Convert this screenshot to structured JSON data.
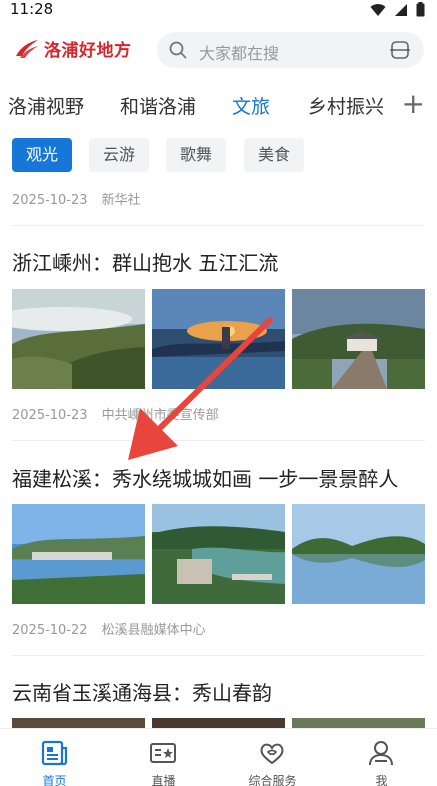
{
  "status_bar": {
    "time": "11:28",
    "icons": [
      "wifi-icon",
      "signal-icon",
      "battery-icon"
    ]
  },
  "header": {
    "logo_text": "洛浦好地方",
    "search_placeholder": "大家都在搜"
  },
  "tabs": {
    "items": [
      "洛浦视野",
      "和谐洛浦",
      "文旅",
      "乡村振兴"
    ],
    "active": "文旅",
    "more_label": "+"
  },
  "subtabs": {
    "items": [
      "观光",
      "云游",
      "歌舞",
      "美食"
    ],
    "active": "观光"
  },
  "feed": [
    {
      "date": "2025-10-23",
      "source": "新华社"
    },
    {
      "title": "浙江嵊州：群山抱水 五江汇流",
      "date": "2025-10-23",
      "source": "中共嵊州市委宣传部"
    },
    {
      "title": "福建松溪：秀水绕城城如画 一步一景景醉人",
      "date": "2025-10-22",
      "source": "松溪县融媒体中心"
    },
    {
      "title": "云南省玉溪通海县：秀山春韵"
    }
  ],
  "bottom_nav": {
    "items": [
      "首页",
      "直播",
      "综合服务",
      "我"
    ],
    "active": "首页"
  },
  "colors": {
    "accent": "#1677d9",
    "brand_red": "#d9262c",
    "annotation_arrow": "#e8453c"
  }
}
